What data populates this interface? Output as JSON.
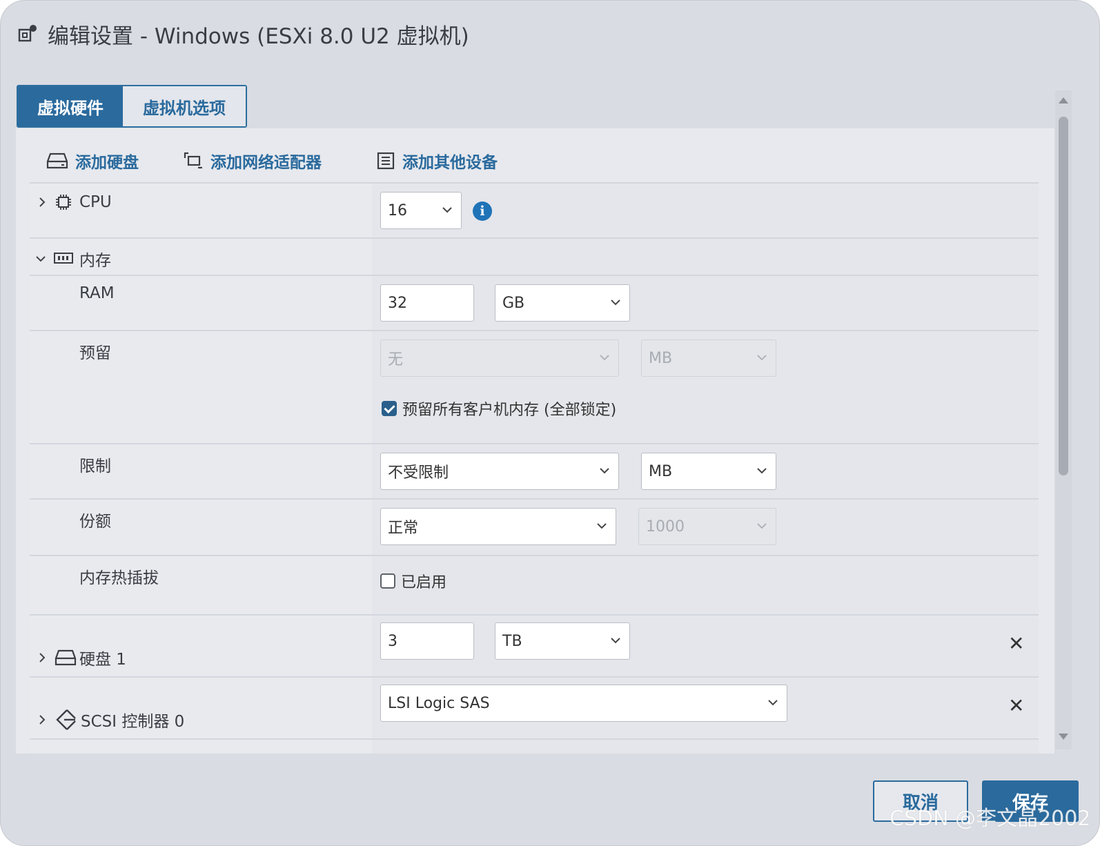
{
  "dialog": {
    "title": "编辑设置 - Windows (ESXi 8.0 U2 虚拟机)",
    "tabs": [
      {
        "label": "虚拟硬件",
        "active": true
      },
      {
        "label": "虚拟机选项",
        "active": false
      }
    ]
  },
  "toolbar": {
    "add_disk": "添加硬盘",
    "add_network": "添加网络适配器",
    "add_other": "添加其他设备"
  },
  "cpu": {
    "label": "CPU",
    "value": "16"
  },
  "memory": {
    "label": "内存",
    "ram": {
      "label": "RAM",
      "value": "32",
      "unit": "GB"
    },
    "reservation": {
      "label": "预留",
      "value": "无",
      "unit": "MB",
      "reserve_all_label": "预留所有客户机内存 (全部锁定)",
      "reserve_all_checked": true
    },
    "limit": {
      "label": "限制",
      "value": "不受限制",
      "unit": "MB"
    },
    "shares": {
      "label": "份额",
      "value": "正常",
      "amount": "1000"
    },
    "hotplug": {
      "label": "内存热插拔",
      "checkbox_label": "已启用",
      "checked": false
    }
  },
  "disk1": {
    "label": "硬盘 1",
    "value": "3",
    "unit": "TB"
  },
  "scsi": {
    "label": "SCSI 控制器 0",
    "value": "LSI Logic SAS"
  },
  "footer": {
    "cancel": "取消",
    "save": "保存"
  },
  "watermark": "CSDN @李文晶2002",
  "colors": {
    "accent": "#2a6a9d",
    "info": "#1f73b7"
  }
}
